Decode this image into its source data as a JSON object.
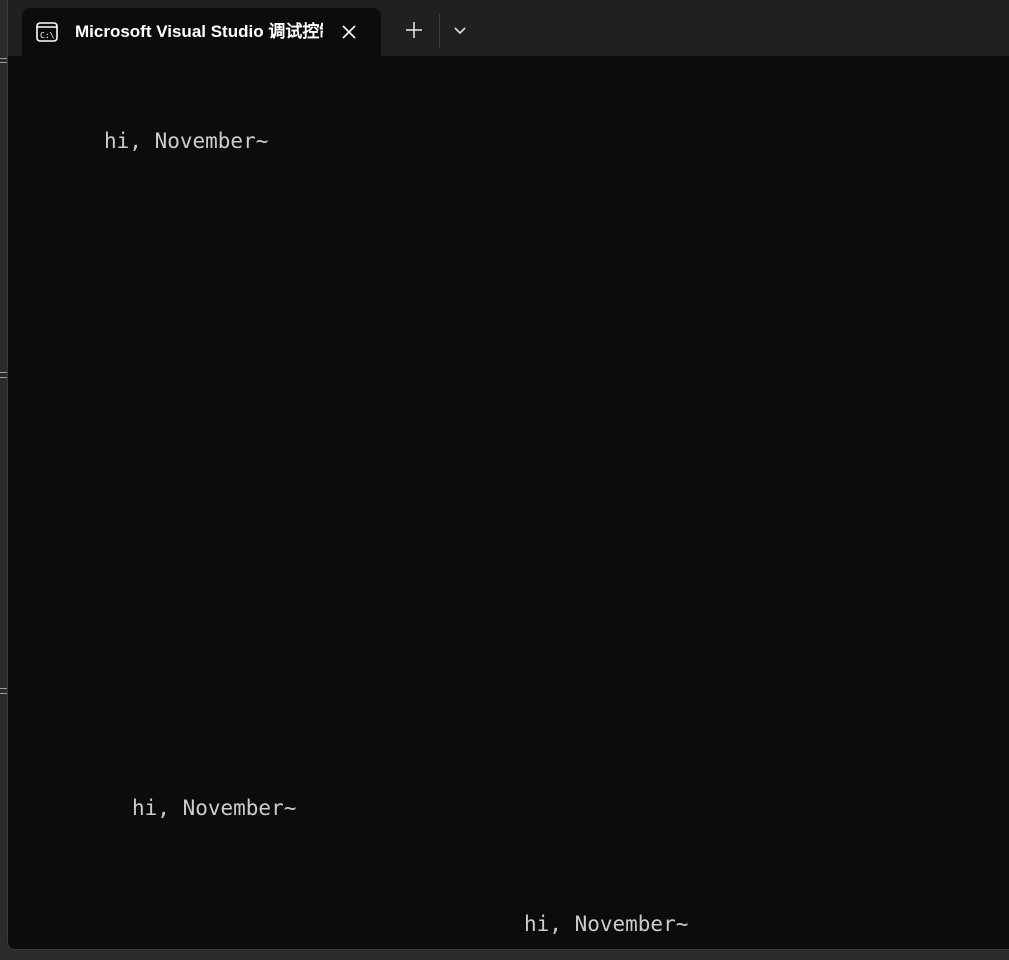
{
  "tab": {
    "title": "Microsoft Visual Studio 调试控制台",
    "icon": "console-icon"
  },
  "toolbar": {
    "new_tab_icon": "plus-icon",
    "dropdown_icon": "chevron-down-icon",
    "close_icon": "close-icon"
  },
  "console": {
    "lines": [
      "hi, November~",
      "hi, November~",
      "hi, November~"
    ]
  },
  "colors": {
    "background": "#0c0c0c",
    "tabbar": "#202020",
    "text": "#cccccc",
    "title": "#ffffff"
  }
}
